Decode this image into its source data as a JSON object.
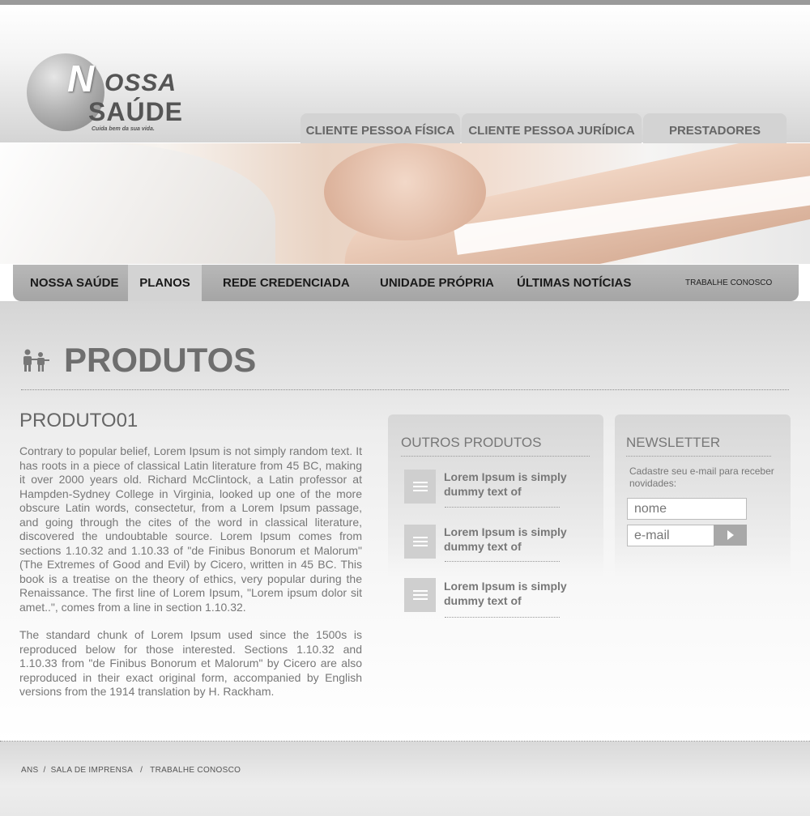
{
  "header": {
    "logo": {
      "letter": "N",
      "word1": "OSSA",
      "word2": "SAÚDE",
      "tagline": "Cuida bem da sua vida."
    },
    "top_tabs": [
      {
        "label": "CLIENTE PESSOA FÍSICA"
      },
      {
        "label": "CLIENTE PESSOA JURÍDICA"
      },
      {
        "label": "PRESTADORES"
      }
    ]
  },
  "nav": {
    "items": [
      {
        "label": "NOSSA SAÚDE"
      },
      {
        "label": "PLANOS",
        "active": true
      },
      {
        "label": "REDE CREDENCIADA"
      },
      {
        "label": "UNIDADE PRÓPRIA"
      },
      {
        "label": "ÚLTIMAS NOTÍCIAS"
      }
    ],
    "small_link": "TRABALHE CONOSCO"
  },
  "page": {
    "title": "PRODUTOS",
    "title_icon": "people-icon"
  },
  "product": {
    "name": "PRODUTO01",
    "paragraphs": [
      "Contrary to popular belief, Lorem Ipsum is not simply random text. It has roots in a piece of classical Latin literature from 45 BC, making it over 2000 years old. Richard McClintock, a Latin professor at Hampden-Sydney College in Virginia, looked up one of the more obscure Latin words, consectetur, from a Lorem Ipsum passage, and going through the cites of the word in classical literature, discovered the undoubtable source. Lorem Ipsum comes from sections 1.10.32 and 1.10.33 of \"de Finibus Bonorum et Malorum\" (The Extremes of Good and Evil) by Cicero, written in 45 BC. This book is a treatise on the theory of ethics, very popular during the Renaissance. The first line of Lorem Ipsum, \"Lorem ipsum dolor sit amet..\", comes from a line in section 1.10.32.",
      "The standard chunk of Lorem Ipsum used since the 1500s is reproduced below for those interested. Sections 1.10.32 and 1.10.33 from \"de Finibus Bonorum et Malorum\" by Cicero are also reproduced in their exact original form, accompanied by English versions from the 1914 translation by H. Rackham."
    ]
  },
  "other_products": {
    "title": "OUTROS PRODUTOS",
    "items": [
      {
        "text": "Lorem Ipsum is simply dummy text of",
        "icon": "document-icon"
      },
      {
        "text": "Lorem Ipsum is simply dummy text of",
        "icon": "document-icon"
      },
      {
        "text": "Lorem Ipsum is simply dummy text of",
        "icon": "document-icon"
      }
    ]
  },
  "newsletter": {
    "title": "NEWSLETTER",
    "description": "Cadastre seu e-mail para receber novidades:",
    "name_placeholder": "nome",
    "email_placeholder": "e-mail",
    "submit_icon": "play-arrow-icon"
  },
  "footer": {
    "links": [
      "ANS",
      "SALA DE IMPRENSA",
      "TRABALHE CONOSCO"
    ],
    "separator": "/"
  }
}
